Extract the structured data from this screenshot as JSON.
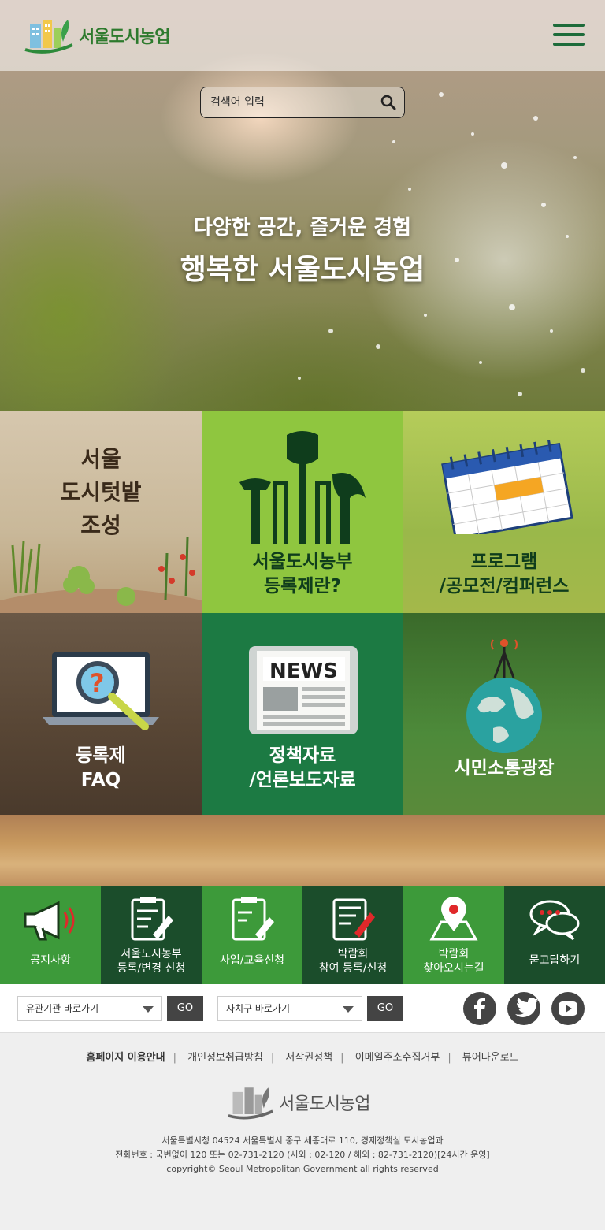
{
  "header": {
    "logo_text": "서울도시농업",
    "menu_icon": "hamburger-icon"
  },
  "search": {
    "placeholder": "검색어 입력",
    "icon": "search-icon"
  },
  "hero": {
    "subtitle": "다양한 공간, 즐거운 경험",
    "title": "행복한 서울도시농업"
  },
  "tiles": [
    {
      "label_lines": [
        "서울",
        "도시텃밭",
        "조성"
      ],
      "icon": "vegetable-garden-icon",
      "color": "#c8b89a"
    },
    {
      "label_lines": [
        "서울도시농부",
        "등록제란?"
      ],
      "icon": "garden-tools-icon",
      "color": "#8fc63f"
    },
    {
      "label_lines": [
        "프로그램",
        "/공모전/컴퍼런스"
      ],
      "icon": "calendar-icon",
      "color": "#a9c24a"
    },
    {
      "label_lines": [
        "등록제",
        "FAQ"
      ],
      "icon": "laptop-magnifier-icon",
      "color": "#5c4a36"
    },
    {
      "label_lines": [
        "정책자료",
        "/언론보도자료"
      ],
      "icon": "newspaper-icon",
      "color": "#1c7a43"
    },
    {
      "label_lines": [
        "시민소통광장"
      ],
      "icon": "globe-antenna-icon",
      "color": "#4d8a3a"
    }
  ],
  "quick_menu": [
    {
      "label_lines": [
        "공지사항"
      ],
      "icon": "megaphone-icon",
      "color": "#3d9a3a"
    },
    {
      "label_lines": [
        "서울도시농부",
        "등록/변경 신청"
      ],
      "icon": "clipboard-pen-icon",
      "color": "#1b4d2b"
    },
    {
      "label_lines": [
        "사업/교육신청"
      ],
      "icon": "clipboard-check-icon",
      "color": "#3d9a3a"
    },
    {
      "label_lines": [
        "박람회",
        "참여 등록/신청"
      ],
      "icon": "form-pen-icon",
      "color": "#1b4d2b"
    },
    {
      "label_lines": [
        "박람회",
        "찾아오시는길"
      ],
      "icon": "map-pin-icon",
      "color": "#3d9a3a"
    },
    {
      "label_lines": [
        "묻고답하기"
      ],
      "icon": "chat-bubbles-icon",
      "color": "#1b4d2b"
    }
  ],
  "select_bar": {
    "select1": "유관기관 바로가기",
    "select2": "자치구 바로가기",
    "go_label": "GO",
    "sns": [
      "facebook-icon",
      "twitter-icon",
      "youtube-icon"
    ]
  },
  "footer": {
    "links": [
      "홈페이지 이용안내",
      "개인정보취급방침",
      "저작권정책",
      "이메일주소수집거부",
      "뷰어다운로드"
    ],
    "logo_text": "서울도시농업",
    "address": "서울특별시청 04524 서울특별시 중구 세종대로 110, 경제정책실 도시농업과",
    "phone": "전화번호 : 국번없이 120 또는 02-731-2120 (시외 : 02-120 / 해외 : 82-731-2120)[24시간 운영]",
    "copyright": "copyright© Seoul Metropolitan Government all rights reserved"
  }
}
